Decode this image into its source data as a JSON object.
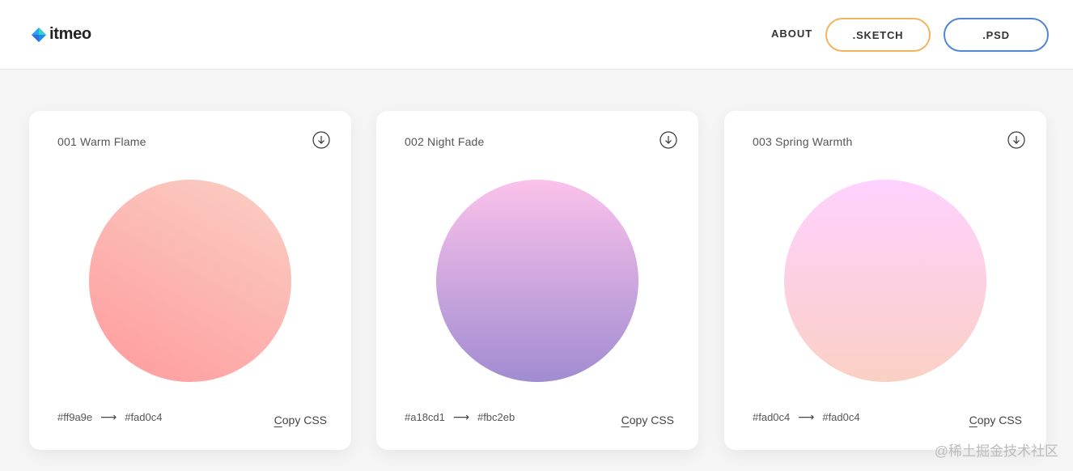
{
  "brand": {
    "name": "itmeo"
  },
  "nav": {
    "about": "ABOUT",
    "sketch": ".SKETCH",
    "psd": ".PSD"
  },
  "colors": {
    "sketch_border": "#f2b45e",
    "psd_border": "#4f86d6"
  },
  "cards": [
    {
      "title": "001 Warm Flame",
      "from": "#ff9a9e",
      "to": "#fad0c4",
      "arrow": "⟶",
      "copy_first": "C",
      "copy_rest": "opy CSS",
      "icon": "download-icon"
    },
    {
      "title": "002 Night Fade",
      "from": "#a18cd1",
      "to": "#fbc2eb",
      "arrow": "⟶",
      "copy_first": "C",
      "copy_rest": "opy CSS",
      "icon": "download-icon"
    },
    {
      "title": "003 Spring Warmth",
      "from": "#fad0c4",
      "to": "#fad0c4",
      "arrow": "⟶",
      "copy_first": "C",
      "copy_rest": "opy CSS",
      "icon": "download-icon"
    }
  ],
  "watermark": "@稀土掘金技术社区"
}
